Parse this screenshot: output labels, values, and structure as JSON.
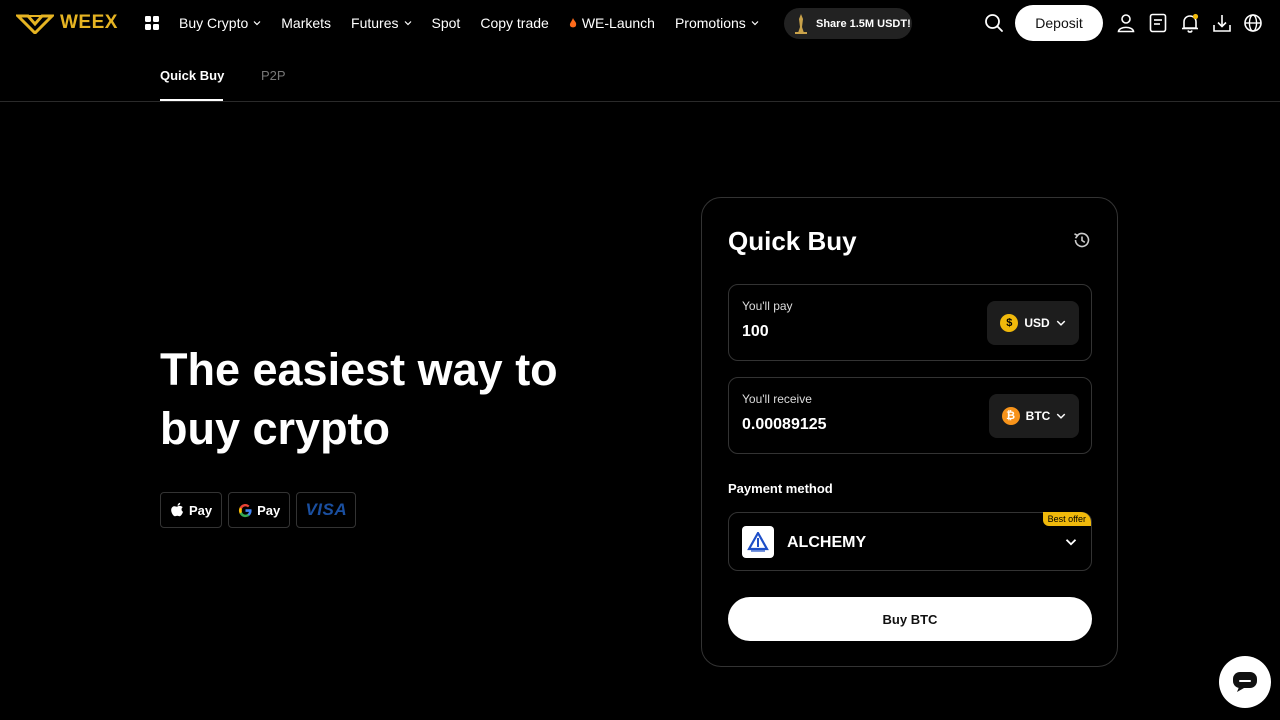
{
  "brand": {
    "name": "WEEX",
    "accent": "#e6b422"
  },
  "nav": {
    "items": [
      {
        "label": "Buy Crypto",
        "dropdown": true
      },
      {
        "label": "Markets",
        "dropdown": false
      },
      {
        "label": "Futures",
        "dropdown": true
      },
      {
        "label": "Spot",
        "dropdown": false
      },
      {
        "label": "Copy trade",
        "dropdown": false
      },
      {
        "label": "WE-Launch",
        "dropdown": false
      },
      {
        "label": "Promotions",
        "dropdown": true
      }
    ],
    "promo": "Share 1.5M USDT!",
    "deposit_label": "Deposit",
    "icons": [
      "search-icon",
      "user-icon",
      "orders-icon",
      "bell-icon",
      "download-icon",
      "globe-icon"
    ]
  },
  "subnav": {
    "tabs": [
      {
        "label": "Quick Buy",
        "active": true
      },
      {
        "label": "P2P",
        "active": false
      }
    ]
  },
  "hero": {
    "line1": "The easiest way to",
    "line2": "buy crypto",
    "payments": [
      "Pay",
      "Pay",
      "VISA"
    ]
  },
  "card": {
    "title": "Quick Buy",
    "pay": {
      "label": "You'll pay",
      "value": "100",
      "currency": "USD"
    },
    "receive": {
      "label": "You'll receive",
      "value": "0.00089125",
      "currency": "BTC"
    },
    "payment_method_label": "Payment method",
    "provider": "ALCHEMY",
    "best_offer": "Best offer",
    "buy_label": "Buy BTC"
  }
}
